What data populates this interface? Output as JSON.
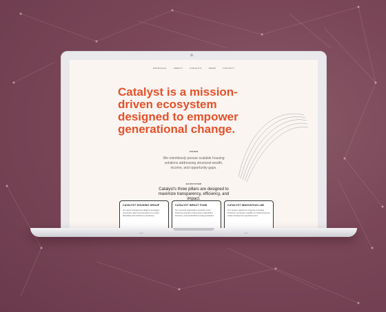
{
  "nav": {
    "items": [
      "Approach",
      "Impact",
      "Insights",
      "News",
      "Contact"
    ]
  },
  "hero": {
    "headline": "Catalyst is a mission-driven ecosystem designed to empower generational change."
  },
  "vision": {
    "label": "VISION",
    "text": "We relentlessly pursue scalable housing solutions addressing structural wealth, income, and opportunity gaps."
  },
  "ecosystem": {
    "label": "ECOSYSTEM",
    "text": "Catalyst's three pillars are designed to maximize transparency, efficiency, and impact.",
    "cards": [
      {
        "title": "CATALYST HOUSING GROUP",
        "body": "Our asset management platform leverages proprietary data and automation to provide affordable and workforce operational"
      },
      {
        "title": "CATALYST IMPACT FUND",
        "body": "Our nonprofit organization provides novel financing structures that preserve affordable, inclusive, and sustainable housing production"
      },
      {
        "title": "CATALYST INNOVATION LAB",
        "body": "Our venture capital arm supports emerging PropTech companies capable of modernizing real estate development operations and"
      }
    ]
  },
  "colors": {
    "accent": "#e4512a",
    "background": "#7a4758",
    "page": "#fbf5f1"
  }
}
